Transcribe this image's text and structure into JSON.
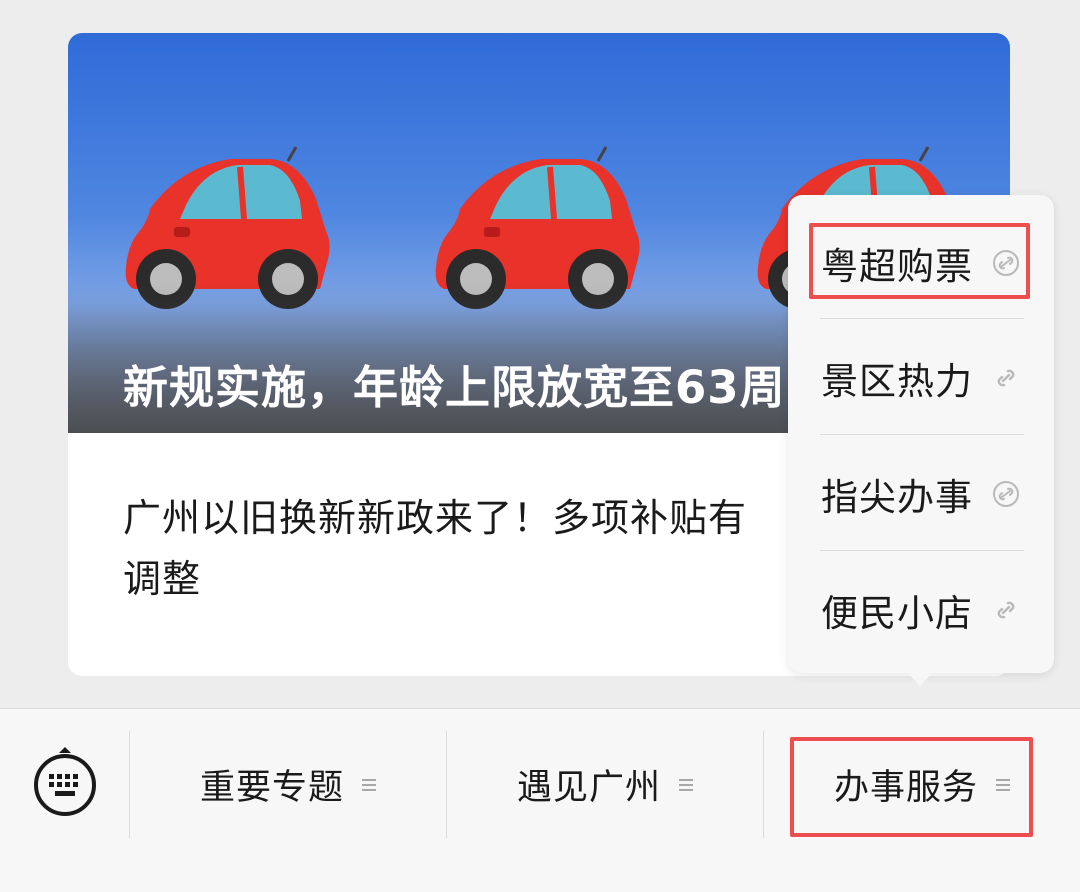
{
  "article": {
    "cover_caption": "新规实施，年龄上限放宽至63周",
    "title": "广州以旧换新新政来了！多项补贴有调整"
  },
  "popup_menu": {
    "items": [
      {
        "label": "粤超购票",
        "icon": "mini-program-link-icon"
      },
      {
        "label": "景区热力",
        "icon": "link-icon"
      },
      {
        "label": "指尖办事",
        "icon": "mini-program-link-icon"
      },
      {
        "label": "便民小店",
        "icon": "link-icon"
      }
    ]
  },
  "bottom_bar": {
    "keyboard_icon": "keyboard-icon",
    "items": [
      {
        "label": "重要专题"
      },
      {
        "label": "遇见广州"
      },
      {
        "label": "办事服务"
      }
    ]
  },
  "colors": {
    "highlight": "#ef4e4e",
    "background": "#ededed",
    "car_body": "#e8322a"
  }
}
